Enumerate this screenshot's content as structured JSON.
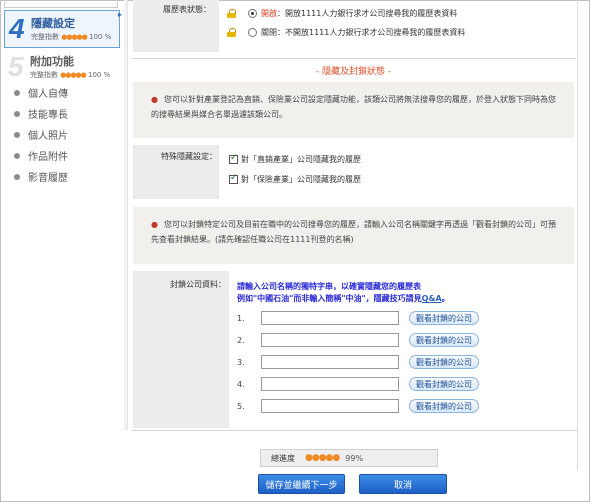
{
  "sidebar": {
    "steps": [
      {
        "num": "4",
        "title": "隱藏設定",
        "meter_label": "完整指數",
        "meter_dots": "●●●●●",
        "meter_pct": "100 %"
      },
      {
        "num": "5",
        "title": "附加功能",
        "meter_label": "完整指數",
        "meter_dots": "●●●●●",
        "meter_pct": "100 %"
      }
    ],
    "items": [
      {
        "label": "個人自傳"
      },
      {
        "label": "技能專長"
      },
      {
        "label": "個人照片"
      },
      {
        "label": "作品附件"
      },
      {
        "label": "影音履歷"
      }
    ]
  },
  "visibility": {
    "label": "履歷表狀態：",
    "open_label": "開啟",
    "open_desc": "：開放1111人力銀行求才公司搜尋我的履歷表資料",
    "close_label": "關閉",
    "close_desc": "：不開放1111人力銀行求才公司搜尋我的履歷表資料"
  },
  "section_title": "- 隱藏及封鎖狀態 -",
  "info1": "您可以針對產業登記為直銷、保險業公司設定隱藏功能，該類公司將無法搜尋您的履歷，於登入狀態下同時為您的搜尋結果與媒合名單過濾該類公司。",
  "special": {
    "label": "特殊隱藏設定：",
    "opt1": "對「直銷產業」公司隱藏我的履歷",
    "opt2": "對「保險產業」公司隱藏我的履歷"
  },
  "info2": "您可以封鎖特定公司及目前在職中的公司搜尋您的履歷，請輸入公司名稱關鍵字再透過「觀看封鎖的公司」可預先查看封鎖結果。(請先確認任職公司在1111刊登的名稱)",
  "block": {
    "label": "封鎖公司資料：",
    "hint_line1": "請輸入公司名稱的獨特字串，以確實隱藏您的履歷表",
    "hint_line2a": "例如\"中國石油\"而非輸入簡稱\"中油\"，隱藏技巧請見",
    "hint_qa": "Q&A",
    "hint_line2b": "。",
    "entries": [
      {
        "idx": "1."
      },
      {
        "idx": "2."
      },
      {
        "idx": "3."
      },
      {
        "idx": "4."
      },
      {
        "idx": "5."
      }
    ],
    "view_button": "觀看封鎖的公司"
  },
  "progress": {
    "label": "總進度",
    "dots": "●●●●●",
    "pct": "99%",
    "value": 0.99
  },
  "actions": {
    "save_next": "儲存並繼續下一步",
    "cancel": "取消"
  }
}
